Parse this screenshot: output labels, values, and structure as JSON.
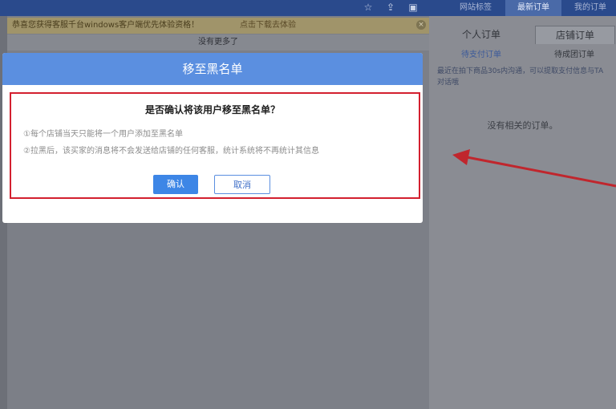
{
  "top_tabs": [
    "网站标签",
    "最新订单",
    "我的订单"
  ],
  "notice": {
    "text": "恭喜您获得客服千台windows客户端优先体验资格！",
    "link": "点击下载去体验",
    "close": "×"
  },
  "chat": {
    "no_more": "没有更多了"
  },
  "right_panel": {
    "tabs": [
      "个人订单",
      "店铺订单"
    ],
    "sub_tabs": [
      "待支付订单",
      "待成团订单"
    ],
    "tip": "最近在拍下商品30s内沟通，可以提取支付信息与TA对话哦",
    "empty": "没有相关的订单。"
  },
  "dialog": {
    "title": "移至黑名单",
    "question": "是否确认将该用户移至黑名单？",
    "tip1": "①每个店铺当天只能将一个用户添加至黑名单",
    "tip2": "②拉黑后，该买家的消息将不会发送给店铺的任何客服，统计系统将不再统计其信息",
    "confirm_label": "确认",
    "cancel_label": "取消"
  },
  "colors": {
    "dialog_header": "#5b8fe0",
    "highlight_border": "#d3202f",
    "confirm_button": "#3d86e6",
    "annotation_arrow": "#c0262d"
  }
}
